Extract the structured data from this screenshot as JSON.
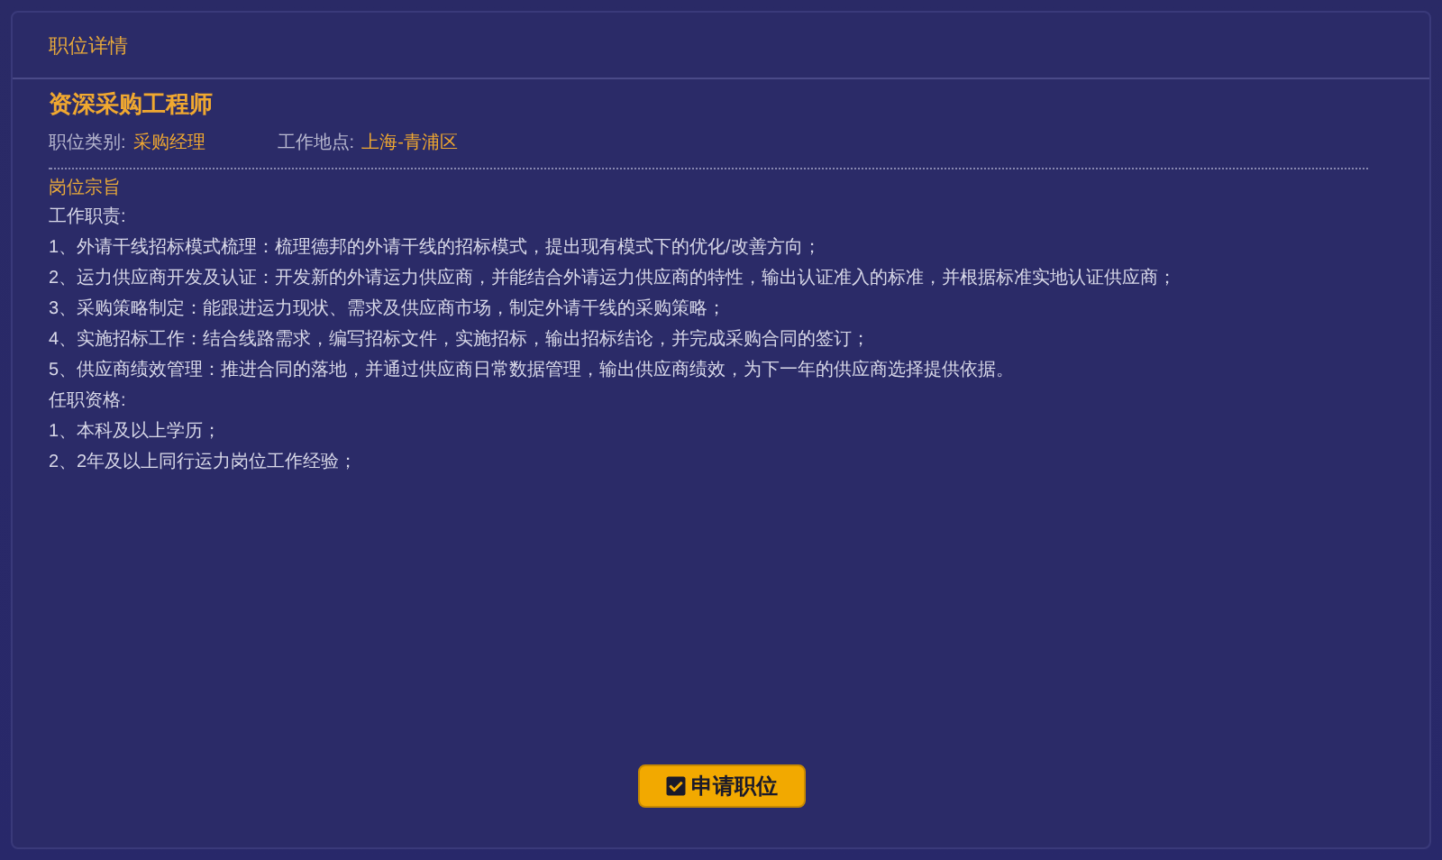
{
  "section_title": "职位详情",
  "job_title": "资深采购工程师",
  "meta": [
    {
      "label": "职位类别:",
      "value": "采购经理"
    },
    {
      "label": "工作地点:",
      "value": "上海-青浦区"
    }
  ],
  "description": {
    "heading": "岗位宗旨",
    "lines": [
      "工作职责:",
      "1、外请干线招标模式梳理：梳理德邦的外请干线的招标模式，提出现有模式下的优化/改善方向；",
      "2、运力供应商开发及认证：开发新的外请运力供应商，并能结合外请运力供应商的特性，输出认证准入的标准，并根据标准实地认证供应商；",
      "3、采购策略制定：能跟进运力现状、需求及供应商市场，制定外请干线的采购策略；",
      "4、实施招标工作：结合线路需求，编写招标文件，实施招标，输出招标结论，并完成采购合同的签订；",
      "5、供应商绩效管理：推进合同的落地，并通过供应商日常数据管理，输出供应商绩效，为下一年的供应商选择提供依据。",
      "任职资格:",
      "1、本科及以上学历；",
      "2、2年及以上同行运力岗位工作经验；"
    ]
  },
  "apply_button": "申请职位"
}
